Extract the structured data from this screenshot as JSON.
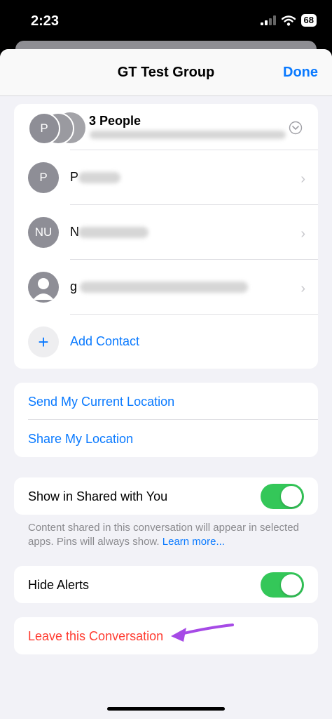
{
  "status": {
    "time": "2:23",
    "battery": "68"
  },
  "header": {
    "title": "GT Test Group",
    "done": "Done"
  },
  "members": {
    "group_label": "3 People",
    "rows": [
      {
        "initials": "P",
        "name_visible": "P"
      },
      {
        "initials": "NU",
        "name_visible": "N"
      },
      {
        "initials": "",
        "name_visible": "g"
      }
    ],
    "add_contact": "Add Contact"
  },
  "location": {
    "send": "Send My Current Location",
    "share": "Share My Location"
  },
  "shared": {
    "label": "Show in Shared with You",
    "enabled": true,
    "footnote": "Content shared in this conversation will appear in selected apps. Pins will always show.",
    "learn_more": "Learn more..."
  },
  "alerts": {
    "label": "Hide Alerts",
    "enabled": true
  },
  "leave": {
    "label": "Leave this Conversation"
  },
  "colors": {
    "accent": "#0a7aff",
    "toggle_on": "#34c759",
    "destructive": "#ff3b30",
    "annotation_arrow": "#a64ae6"
  }
}
